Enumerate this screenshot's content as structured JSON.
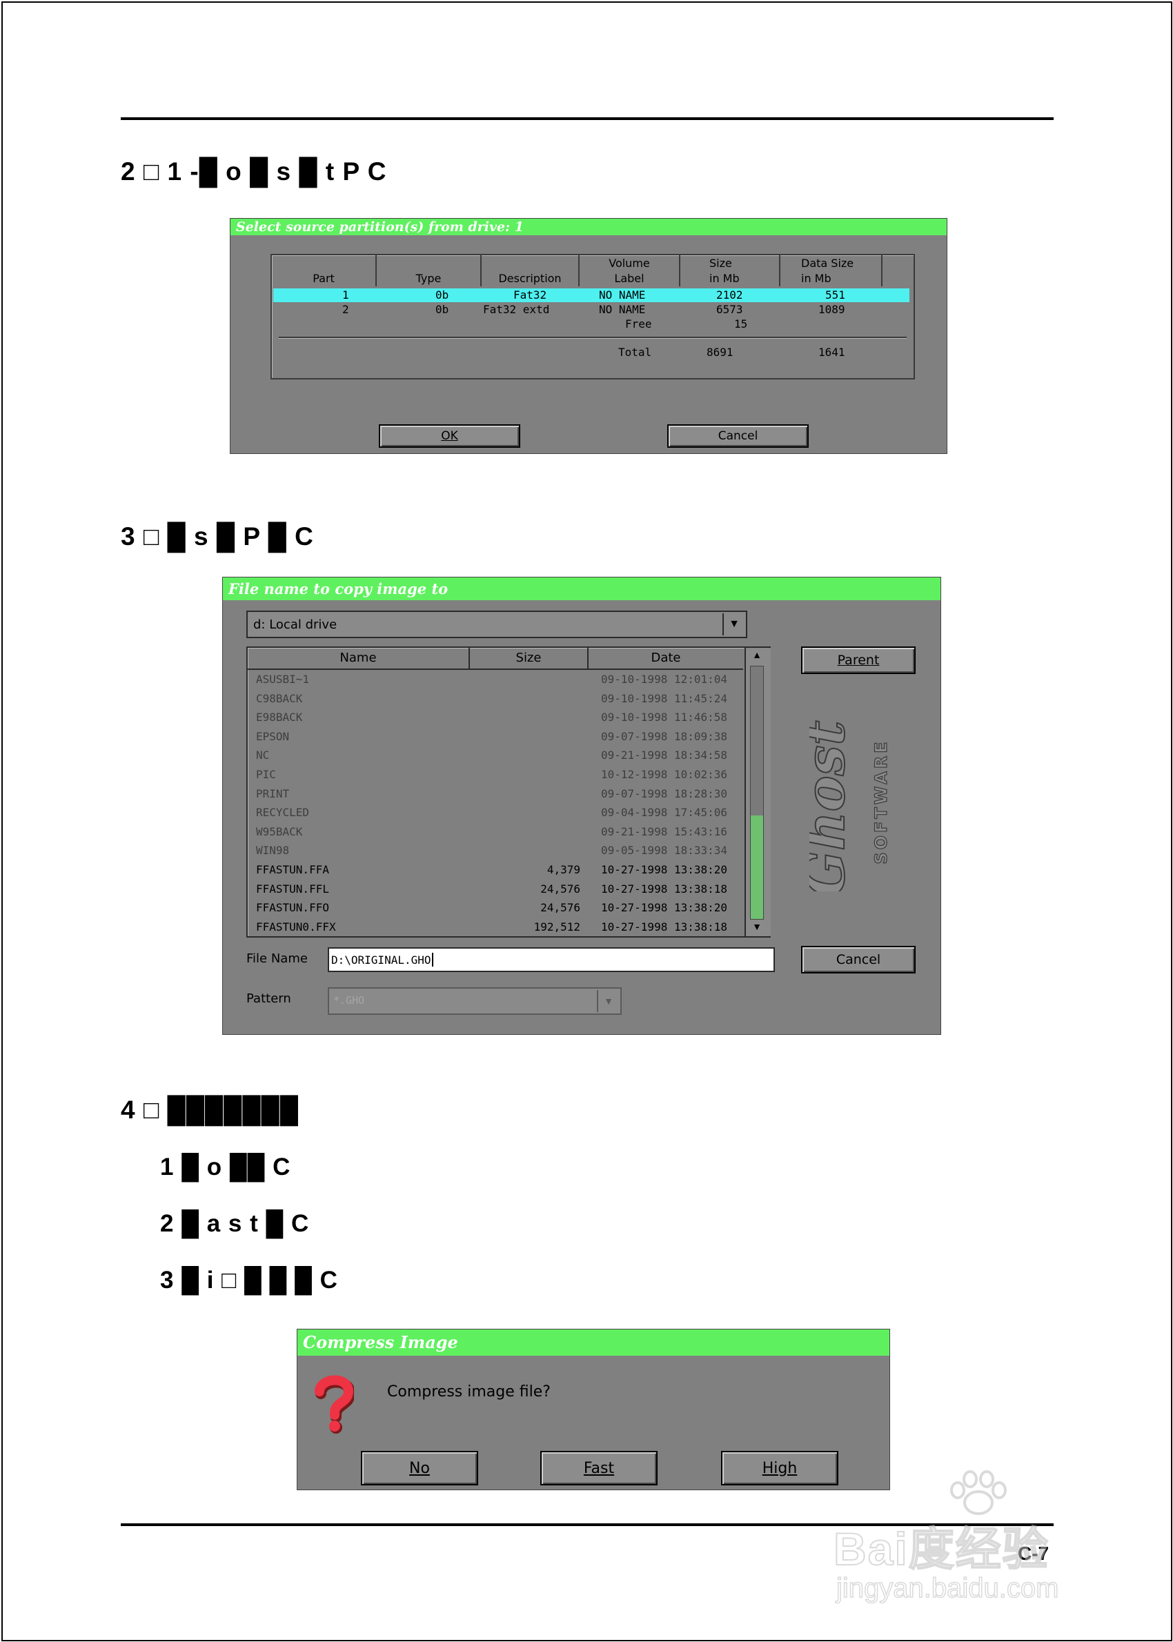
{
  "page": {
    "number": "C-7"
  },
  "steps": {
    "s2": "2 □ 1 -█ o █ s █ t P C",
    "s3": "3 □ █ s █ P █ C",
    "s4": "4 □ ███████",
    "s4_1": "1 █ o      ██ C",
    "s4_2": "2 █ a s t      █ C",
    "s4_3": "3 █ i □        █ █ █ C"
  },
  "dialog1": {
    "title": "Select source partition(s) from drive: 1",
    "columns": [
      {
        "line1": "",
        "line2": "Part"
      },
      {
        "line1": "",
        "line2": "Type"
      },
      {
        "line1": "",
        "line2": "Description"
      },
      {
        "line1": "Volume",
        "line2": "Label"
      },
      {
        "line1": "Size",
        "line2": "in Mb"
      },
      {
        "line1": "Data Size",
        "line2": "in Mb"
      }
    ],
    "rows": [
      {
        "part": "1",
        "type": "0b",
        "desc": "Fat32",
        "label": "NO NAME",
        "size": "2102",
        "data": "551"
      },
      {
        "part": "2",
        "type": "0b",
        "desc": "Fat32 extd",
        "label": "NO NAME",
        "size": "6573",
        "data": "1089"
      },
      {
        "part": "",
        "type": "",
        "desc": "",
        "label": "Free",
        "size": "15",
        "data": ""
      }
    ],
    "total": {
      "label": "Total",
      "size": "8691",
      "data": "1641"
    },
    "ok": "OK",
    "cancel": "Cancel"
  },
  "dialog2": {
    "title": "File name to copy image to",
    "drive": "d: Local drive",
    "columns": [
      "Name",
      "Size",
      "Date"
    ],
    "files": [
      {
        "name": "ASUSBI~1",
        "size": "",
        "date": "09-10-1998 12:01:04",
        "dir": true
      },
      {
        "name": "C98BACK",
        "size": "",
        "date": "09-10-1998 11:45:24",
        "dir": true
      },
      {
        "name": "E98BACK",
        "size": "",
        "date": "09-10-1998 11:46:58",
        "dir": true
      },
      {
        "name": "EPSON",
        "size": "",
        "date": "09-07-1998 18:09:38",
        "dir": true
      },
      {
        "name": "NC",
        "size": "",
        "date": "09-21-1998 18:34:58",
        "dir": true
      },
      {
        "name": "PIC",
        "size": "",
        "date": "10-12-1998 10:02:36",
        "dir": true
      },
      {
        "name": "PRINT",
        "size": "",
        "date": "09-07-1998 18:28:30",
        "dir": true
      },
      {
        "name": "RECYCLED",
        "size": "",
        "date": "09-04-1998 17:45:06",
        "dir": true
      },
      {
        "name": "W95BACK",
        "size": "",
        "date": "09-21-1998 15:43:16",
        "dir": true
      },
      {
        "name": "WIN98",
        "size": "",
        "date": "09-05-1998 18:33:34",
        "dir": true
      },
      {
        "name": "FFASTUN.FFA",
        "size": "4,379",
        "date": "10-27-1998 13:38:20",
        "dir": false
      },
      {
        "name": "FFASTUN.FFL",
        "size": "24,576",
        "date": "10-27-1998 13:38:18",
        "dir": false
      },
      {
        "name": "FFASTUN.FFO",
        "size": "24,576",
        "date": "10-27-1998 13:38:20",
        "dir": false
      },
      {
        "name": "FFASTUN0.FFX",
        "size": "192,512",
        "date": "10-27-1998 13:38:18",
        "dir": false
      }
    ],
    "parent": "Parent",
    "cancel": "Cancel",
    "file_name_label": "File Name",
    "file_name_value": "D:\\ORIGINAL.GHO",
    "pattern_label": "Pattern",
    "pattern_value": "*.GHO",
    "logo_main": "Ghost",
    "logo_sub": "SOFTWARE"
  },
  "dialog3": {
    "title": "Compress Image",
    "question": "Compress image file?",
    "icon": "question-mark-icon",
    "no": "No",
    "fast": "Fast",
    "high": "High"
  },
  "watermark": {
    "brand": "Bai度经验",
    "url": "jingyan.baidu.com"
  },
  "colors": {
    "titlebar": "#5ff05f",
    "selected_row": "#4ff0f0",
    "dialog_bg": "#808080"
  }
}
